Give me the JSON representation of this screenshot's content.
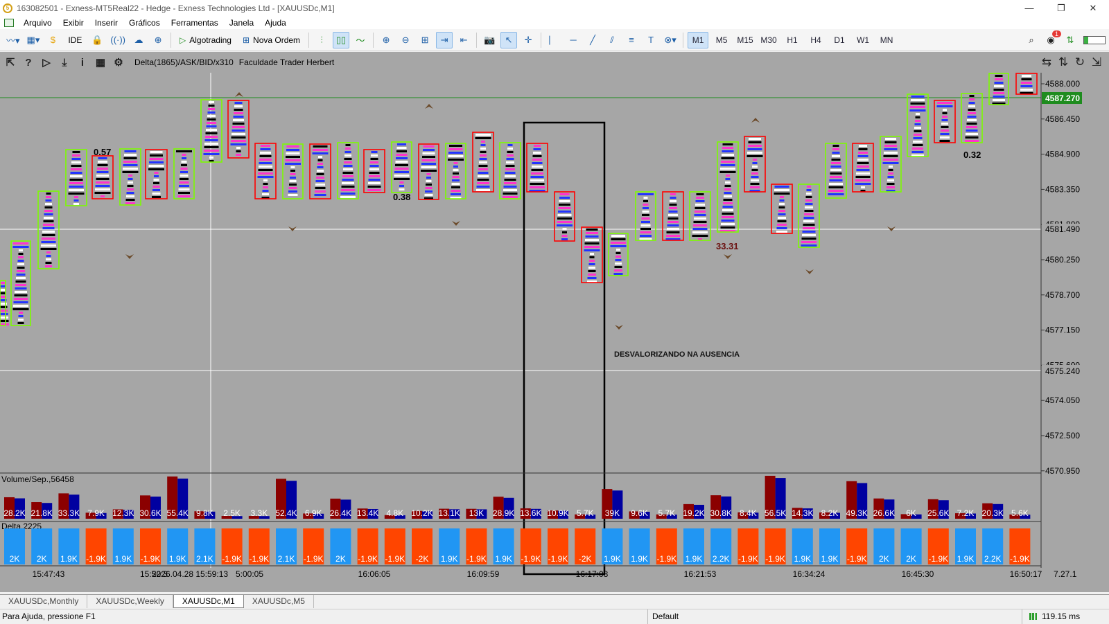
{
  "window": {
    "title": "163082501 - Exness-MT5Real22 - Hedge - Exness Technologies Ltd - [XAUUSDc,M1]",
    "minimize": "—",
    "restore": "❐",
    "close": "✕"
  },
  "menu": [
    "Arquivo",
    "Exibir",
    "Inserir",
    "Gráficos",
    "Ferramentas",
    "Janela",
    "Ajuda"
  ],
  "toolbar": {
    "ide": "IDE",
    "algotrading": "Algotrading",
    "nova_ordem": "Nova Ordem",
    "timeframes": [
      "M1",
      "M5",
      "M15",
      "M30",
      "H1",
      "H4",
      "D1",
      "W1",
      "MN"
    ],
    "active_timeframe": "M1",
    "notification_count": "1"
  },
  "chart": {
    "indicator": "Delta(1865)/ASK/BID/x310",
    "author": "Faculdade Trader Herbert",
    "annotation": "DESVALORIZANDO NA AUSENCIA",
    "price_labels": [
      "4588.000",
      "4586.450",
      "4584.900",
      "4583.350",
      "4581.800",
      "4580.250",
      "4578.700",
      "4577.150",
      "4575.600",
      "4574.050",
      "4572.500",
      "4570.950"
    ],
    "current_price": "4587.270",
    "crosshair_price": "4581.490",
    "line_price": "4575.240",
    "time_labels": [
      "15:47:43",
      "15:52:3",
      "2026.04.28 15:59:13",
      "5:00:05",
      "16:06:05",
      "16:09:59",
      "16:17:08",
      "16:21:53",
      "16:34:24",
      "16:45:30",
      "16:50:17"
    ],
    "version": "7.27.1",
    "delta_marks": [
      "0.57",
      "0.38",
      "33.31",
      "0.32"
    ],
    "volume_panel_label": "Volume/Sep.,56458",
    "delta_panel_label": "Delta,2225",
    "volume_labels": [
      "28.2K",
      "21.8K",
      "33.3K",
      "7.9K",
      "12.3K",
      "30.6K",
      "55.4K",
      "9.8K",
      "2.5K",
      "3.3K",
      "52.4K",
      "6.9K",
      "26.4K",
      "13.4K",
      "4.8K",
      "10.2K",
      "13.1K",
      "13K",
      "28.9K",
      "13.6K",
      "10.9K",
      "5.7K",
      "39K",
      "9.6K",
      "5.7K",
      "19.2K",
      "30.8K",
      "8.4K",
      "56.5K",
      "14.3K",
      "8.2K",
      "49.3K",
      "26.6K",
      "6K",
      "25.6K",
      "7.2K",
      "20.3K",
      "5.6K"
    ],
    "delta_labels": [
      "2K",
      "2K",
      "1.9K",
      "-1.9K",
      "1.9K",
      "-1.9K",
      "1.9K",
      "2.1K",
      "-1.9K",
      "-1.9K",
      "2.1K",
      "-1.9K",
      "2K",
      "-1.9K",
      "-1.9K",
      "-2K",
      "1.9K",
      "-1.9K",
      "1.9K",
      "-1.9K",
      "-1.9K",
      "-2K",
      "1.9K",
      "1.9K",
      "-1.9K",
      "1.9K",
      "2.2K",
      "-1.9K",
      "-1.9K",
      "1.9K",
      "1.9K",
      "-1.9K",
      "2K",
      "2K",
      "-1.9K",
      "1.9K",
      "2.2K",
      "-1.9K"
    ]
  },
  "tabs": [
    "XAUUSDc,Monthly",
    "XAUUSDc,Weekly",
    "XAUUSDc,M1",
    "XAUUSDc,M5"
  ],
  "active_tab": "XAUUSDc,M1",
  "status": {
    "help": "Para Ajuda, pressione F1",
    "profile": "Default",
    "ping": "119.15 ms"
  },
  "colors": {
    "bull_box": "#7cfc00",
    "bear_box": "#ff0000",
    "bull_bar": "#2196f3",
    "bear_bar": "#ff4500",
    "vol_ask": "#8b0000",
    "vol_bid": "#0000a0",
    "chart_bg": "#a6a6a6",
    "price_tag": "#1e8c1e"
  }
}
